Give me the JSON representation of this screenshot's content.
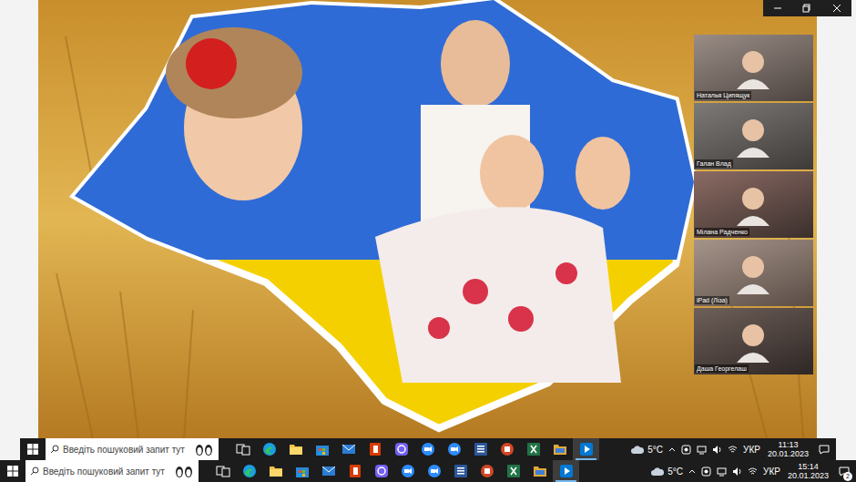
{
  "participants": [
    {
      "name": "Наталья Ципящук"
    },
    {
      "name": "Галан Влад"
    },
    {
      "name": "Мілана Радченко"
    },
    {
      "name": "iPad (Ліза)"
    },
    {
      "name": "Даша Георгелаш"
    }
  ],
  "taskbars": [
    {
      "search": {
        "placeholder": "Введіть пошуковий запит тут"
      },
      "apps": [
        {
          "kind": "taskview",
          "active": false
        },
        {
          "kind": "edge",
          "active": false
        },
        {
          "kind": "explorer",
          "active": false
        },
        {
          "kind": "store",
          "active": false
        },
        {
          "kind": "mail",
          "active": false
        },
        {
          "kind": "office",
          "active": false
        },
        {
          "kind": "viber",
          "active": false
        },
        {
          "kind": "zoom",
          "active": false
        },
        {
          "kind": "zoom",
          "active": false
        },
        {
          "kind": "word",
          "active": false
        },
        {
          "kind": "powerpoint",
          "active": false
        },
        {
          "kind": "excel",
          "active": false
        },
        {
          "kind": "folder",
          "active": false
        },
        {
          "kind": "player",
          "active": true
        }
      ],
      "weather": "5°C",
      "language": "УКР",
      "time": "11:13",
      "date": "20.01.2023"
    },
    {
      "search": {
        "placeholder": "Введіть пошуковий запит тут"
      },
      "apps": [
        {
          "kind": "taskview",
          "active": false
        },
        {
          "kind": "edge",
          "active": false
        },
        {
          "kind": "explorer",
          "active": false
        },
        {
          "kind": "store",
          "active": false
        },
        {
          "kind": "mail",
          "active": false
        },
        {
          "kind": "office",
          "active": false
        },
        {
          "kind": "viber",
          "active": false
        },
        {
          "kind": "zoom",
          "active": false
        },
        {
          "kind": "zoom",
          "active": false
        },
        {
          "kind": "word",
          "active": false
        },
        {
          "kind": "powerpoint",
          "active": false
        },
        {
          "kind": "excel",
          "active": false
        },
        {
          "kind": "folder",
          "active": false
        },
        {
          "kind": "player",
          "active": true
        }
      ],
      "weather": "5°C",
      "language": "УКР",
      "time": "15:14",
      "date": "20.01.2023",
      "notifications": "2"
    }
  ]
}
